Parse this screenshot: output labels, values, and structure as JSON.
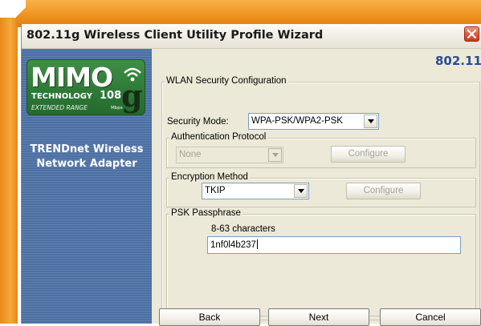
{
  "window": {
    "title": "802.11g Wireless Client Utility Profile Wizard"
  },
  "sidebar": {
    "logo": {
      "word": "MIMO",
      "technology": "TECHNOLOGY",
      "number": "108",
      "letter": "g",
      "range": "EXTENDED RANGE",
      "unit": "Mbps"
    },
    "brand_line1": "TRENDnet Wireless",
    "brand_line2": "Network Adapter"
  },
  "header": {
    "standard": "802.11"
  },
  "wlan_security": {
    "legend": "WLAN Security Configuration",
    "security_mode_label": "Security Mode:",
    "security_mode_value": "WPA-PSK/WPA2-PSK"
  },
  "auth_protocol": {
    "legend": "Authentication Protocol",
    "value": "None",
    "configure_label": "Configure"
  },
  "encryption": {
    "legend": "Encryption Method",
    "value": "TKIP",
    "configure_label": "Configure"
  },
  "psk": {
    "legend": "PSK Passphrase",
    "hint": "8-63 characters",
    "value": "1nf0l4b237"
  },
  "footer": {
    "back_label": "Back",
    "next_label": "Next",
    "cancel_label": "Cancel"
  },
  "colors": {
    "frame_orange": "#ef9420",
    "sidebar_blue": "#4d70a4",
    "dialog_bg": "#ece9d8",
    "brand_blue": "#2b4c93",
    "logo_green": "#2f7a38",
    "close_red": "#e0593e"
  }
}
